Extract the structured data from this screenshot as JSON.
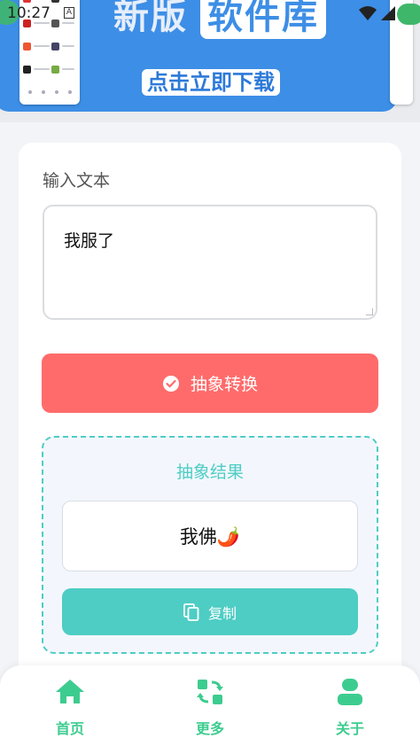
{
  "status_bar": {
    "time": "10:27",
    "notification_glyph": "A"
  },
  "banner": {
    "title_part1": "新版",
    "title_part2": "软件库",
    "cta": "点击立即下载"
  },
  "input": {
    "label": "输入文本",
    "value": "我服了"
  },
  "convert_button": {
    "label": "抽象转换",
    "icon": "check-circle-icon"
  },
  "result": {
    "title": "抽象结果",
    "value": "我佛🌶️"
  },
  "copy_button": {
    "label": "复制",
    "icon": "copy-icon"
  },
  "bottom_nav": {
    "items": [
      {
        "label": "首页",
        "icon": "home-icon"
      },
      {
        "label": "更多",
        "icon": "refresh-icon"
      },
      {
        "label": "关于",
        "icon": "user-icon"
      }
    ]
  },
  "colors": {
    "accent_red": "#ff6b6b",
    "accent_teal": "#4ecdc4",
    "nav_green": "#3dcc8f",
    "banner_blue": "#3d8ee6"
  }
}
